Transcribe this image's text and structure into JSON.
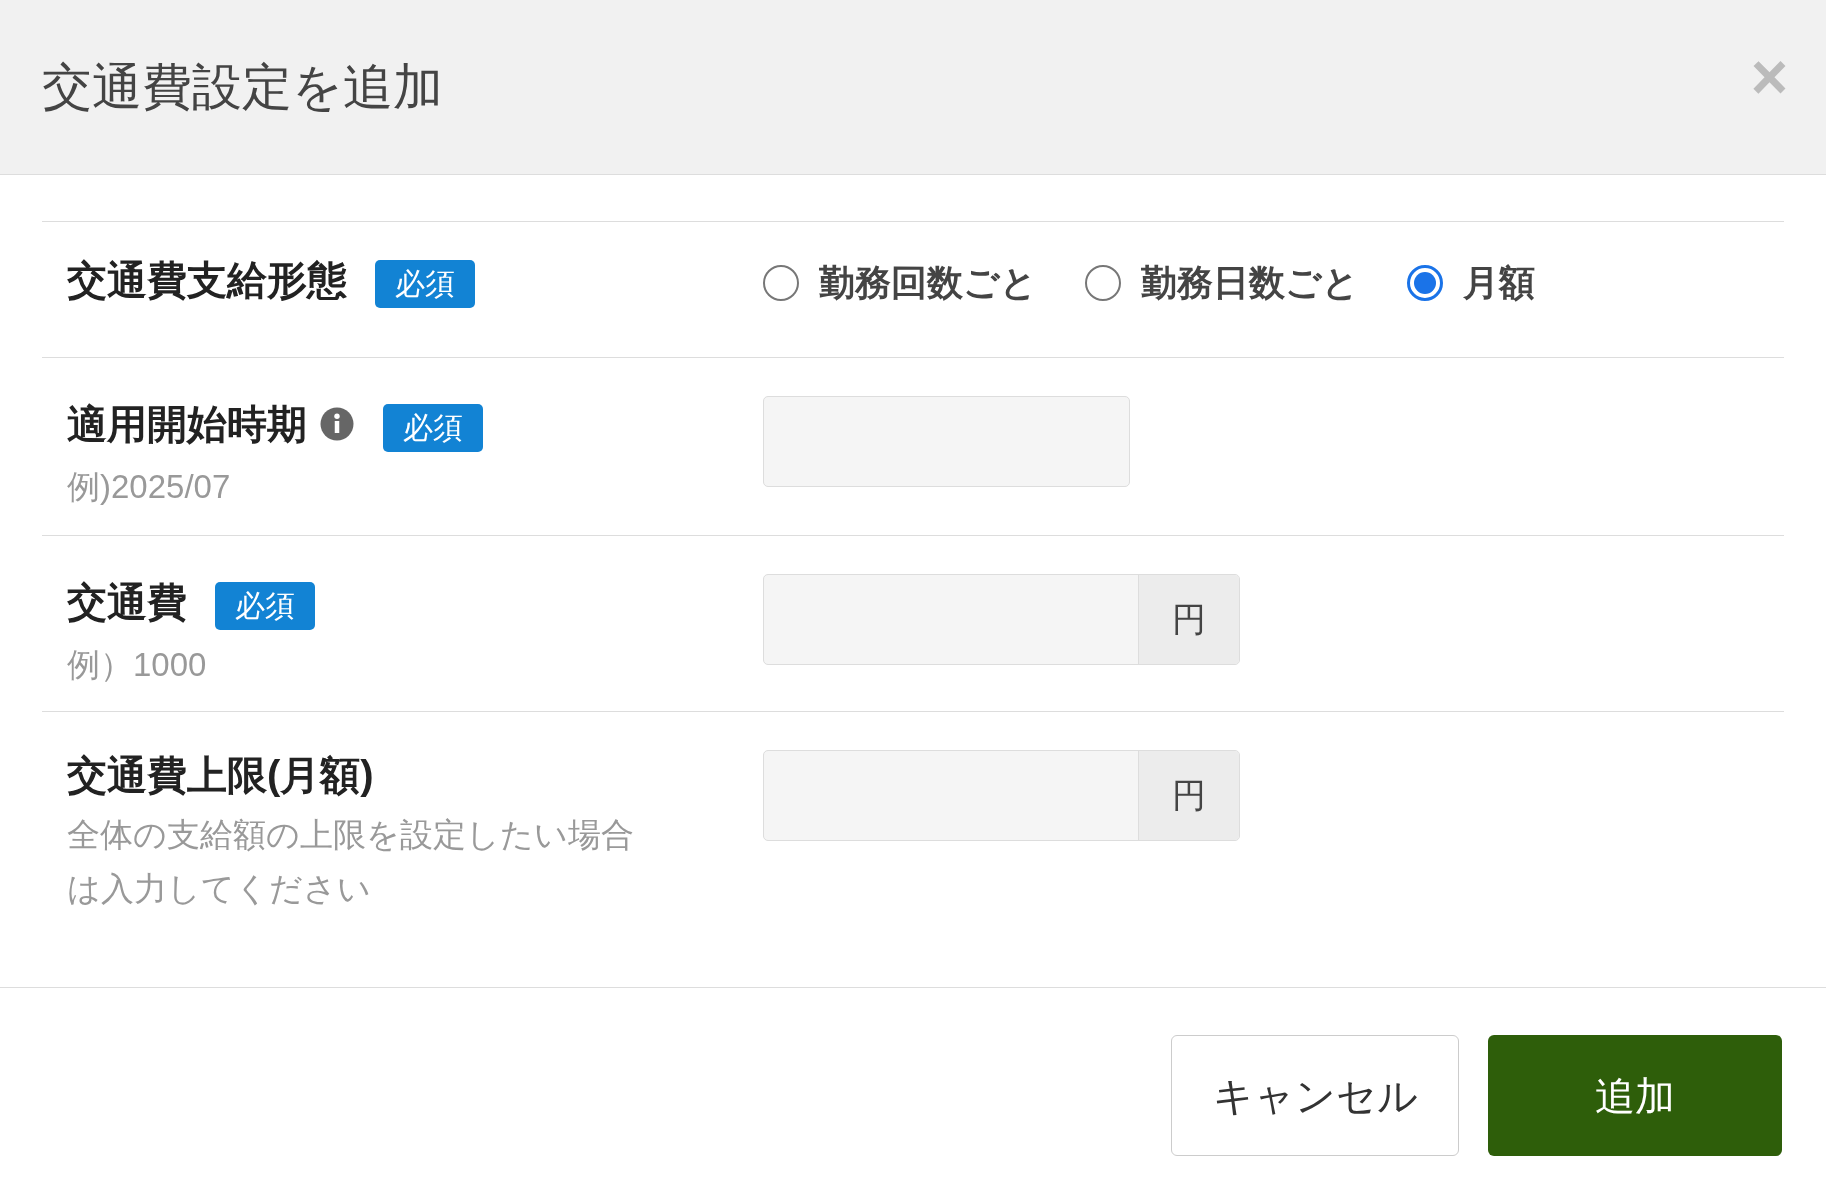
{
  "dialog": {
    "title": "交通費設定を追加",
    "close": "×"
  },
  "fields": [
    {
      "kind": "radio",
      "label": "交通費支給形態",
      "info": false,
      "required": true,
      "badge": "必須",
      "options": [
        {
          "label": "勤務回数ごと",
          "selected": false
        },
        {
          "label": "勤務日数ごと",
          "selected": false
        },
        {
          "label": "月額",
          "selected": true
        }
      ]
    },
    {
      "kind": "text",
      "label": "適用開始時期",
      "info": true,
      "required": true,
      "badge": "必須",
      "hint": "例)2025/07"
    },
    {
      "kind": "yen",
      "label": "交通費",
      "info": false,
      "required": true,
      "badge": "必須",
      "hint": "例）1000",
      "unit": "円"
    },
    {
      "kind": "yen",
      "label": "交通費上限(月額)",
      "info": false,
      "required": false,
      "hint": "全体の支給額の上限を設定したい場合は入力してください",
      "unit": "円"
    }
  ],
  "buttons": {
    "cancel": "キャンセル",
    "submit": "追加"
  }
}
